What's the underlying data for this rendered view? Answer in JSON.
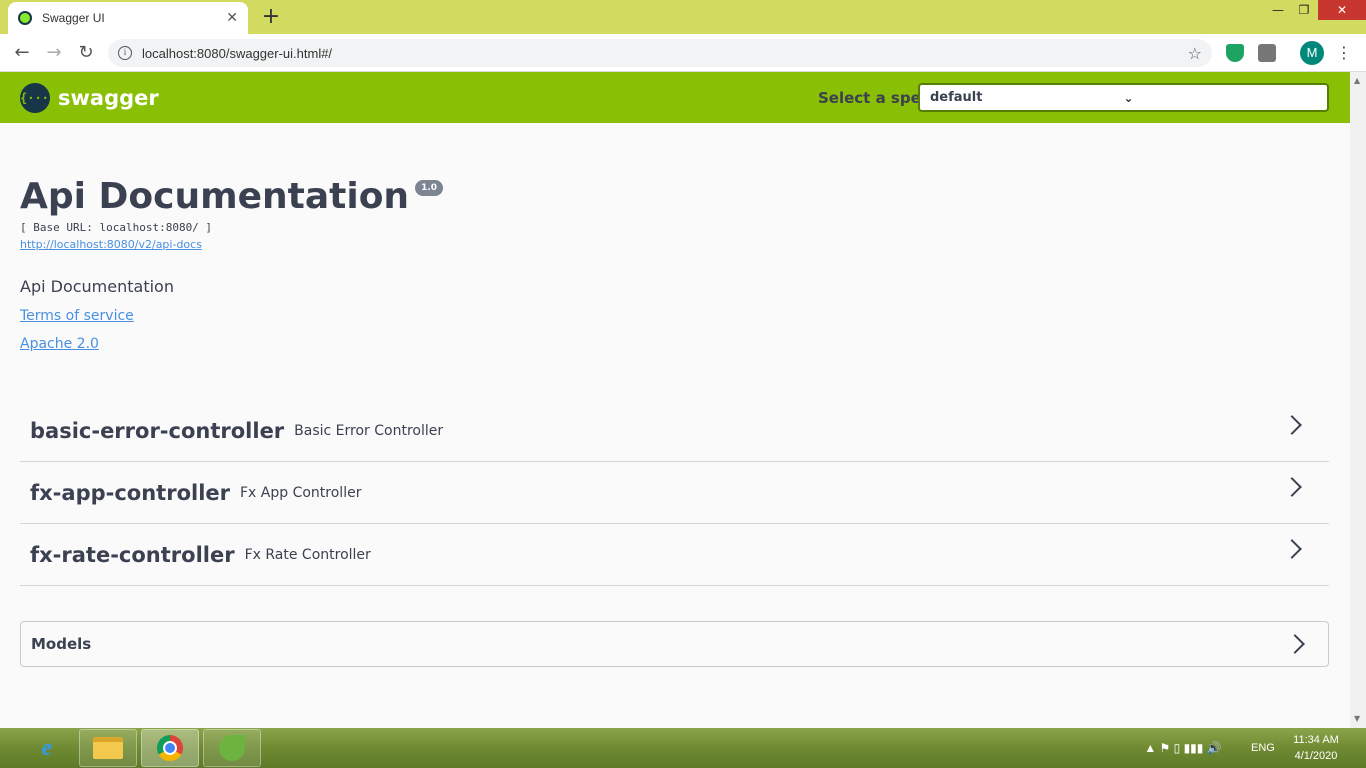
{
  "browser": {
    "tab_title": "Swagger UI",
    "tab_close": "✕",
    "new_tab": "+",
    "url": "localhost:8080/swagger-ui.html#/",
    "back": "←",
    "forward": "→",
    "reload": "↻",
    "star": "☆",
    "profile_initial": "M",
    "menu": "⋮",
    "minimize": "—",
    "maximize": "❐",
    "close": "✕"
  },
  "swagger": {
    "logo_symbol": "{···}",
    "logo_text": "swagger",
    "spec_label": "Select a spec",
    "spec_value": "default",
    "spec_chevron": "⌄"
  },
  "info": {
    "title": "Api Documentation",
    "version": "1.0",
    "base_url": "[ Base URL: localhost:8080/ ]",
    "docs_link": "http://localhost:8080/v2/api-docs",
    "description": "Api Documentation",
    "terms": "Terms of service",
    "license": "Apache 2.0"
  },
  "tags": [
    {
      "name": "basic-error-controller",
      "desc": "Basic Error Controller"
    },
    {
      "name": "fx-app-controller",
      "desc": "Fx App Controller"
    },
    {
      "name": "fx-rate-controller",
      "desc": "Fx Rate Controller"
    }
  ],
  "models": {
    "label": "Models"
  },
  "taskbar": {
    "ie_label": "e",
    "tray_glyphs": "▲  ⚑  ▯  ▮▮▮  🔊",
    "language": "ENG",
    "time": "11:34 AM",
    "date": "4/1/2020"
  },
  "colors": {
    "swagger_green": "#89bf04",
    "text_dark": "#3b4151",
    "link_blue": "#4990e2"
  }
}
